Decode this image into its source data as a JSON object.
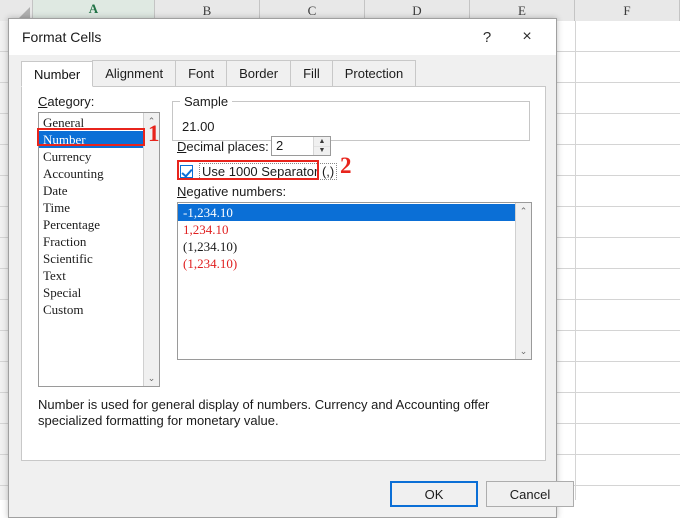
{
  "spreadsheet": {
    "columns": [
      {
        "label": "A",
        "active": true
      },
      {
        "label": "B",
        "active": false
      },
      {
        "label": "C",
        "active": false
      },
      {
        "label": "D",
        "active": false
      },
      {
        "label": "E",
        "active": false
      },
      {
        "label": "F",
        "active": false
      }
    ],
    "select_all_corner": "select-all-corner"
  },
  "dialog": {
    "title": "Format Cells",
    "help_glyph": "?",
    "close_glyph": "×",
    "tabs": [
      {
        "label": "Number",
        "active": true
      },
      {
        "label": "Alignment",
        "active": false
      },
      {
        "label": "Font",
        "active": false
      },
      {
        "label": "Border",
        "active": false
      },
      {
        "label": "Fill",
        "active": false
      },
      {
        "label": "Protection",
        "active": false
      }
    ],
    "category": {
      "label": "Category:",
      "items": [
        {
          "label": "General",
          "selected": false
        },
        {
          "label": "Number",
          "selected": true
        },
        {
          "label": "Currency",
          "selected": false
        },
        {
          "label": "Accounting",
          "selected": false
        },
        {
          "label": "Date",
          "selected": false
        },
        {
          "label": "Time",
          "selected": false
        },
        {
          "label": "Percentage",
          "selected": false
        },
        {
          "label": "Fraction",
          "selected": false
        },
        {
          "label": "Scientific",
          "selected": false
        },
        {
          "label": "Text",
          "selected": false
        },
        {
          "label": "Special",
          "selected": false
        },
        {
          "label": "Custom",
          "selected": false
        }
      ],
      "scroll_up_glyph": "⌃",
      "scroll_down_glyph": "⌄"
    },
    "sample": {
      "legend": "Sample",
      "value": "21.00"
    },
    "decimal_places": {
      "label": "Decimal places:",
      "value": "2",
      "spin_up_glyph": "▲",
      "spin_down_glyph": "▼"
    },
    "thousands_separator": {
      "label": "Use 1000 Separator (,)",
      "checked": true
    },
    "negative_numbers": {
      "label": "Negative numbers:",
      "items": [
        {
          "text": "-1,234.10",
          "style": "selected"
        },
        {
          "text": "1,234.10",
          "style": "red"
        },
        {
          "text": "(1,234.10)",
          "style": "black"
        },
        {
          "text": "(1,234.10)",
          "style": "red"
        }
      ],
      "scroll_up_glyph": "⌃",
      "scroll_down_glyph": "⌄"
    },
    "description": "Number is used for general display of numbers.  Currency and Accounting offer specialized formatting for monetary value.",
    "buttons": {
      "ok": "OK",
      "cancel": "Cancel"
    }
  },
  "annotations": [
    {
      "number": "1",
      "target": "category-number-item"
    },
    {
      "number": "2",
      "target": "use-1000-separator-checkbox"
    }
  ],
  "colors": {
    "selection_blue": "#0b6fd6",
    "annotation_red": "#e8241c",
    "negative_red": "#e02020",
    "excel_green": "#217346"
  }
}
